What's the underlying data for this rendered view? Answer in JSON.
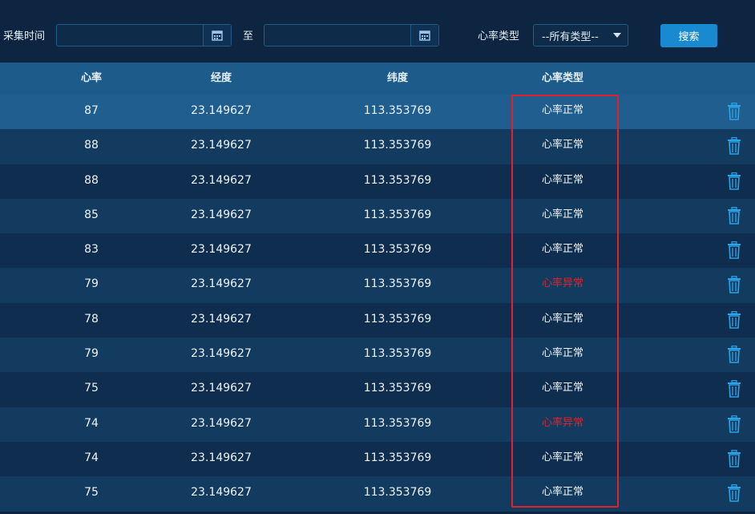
{
  "filters": {
    "time_label": "采集时间",
    "to_label": "至",
    "start_date_value": "",
    "end_date_value": "",
    "type_label": "心率类型",
    "type_select_value": "--所有类型--",
    "search_label": "搜索"
  },
  "table": {
    "headers": {
      "heart_rate": "心率",
      "longitude": "经度",
      "latitude": "纬度",
      "heart_rate_type": "心率类型"
    },
    "rows": [
      {
        "hr": "87",
        "lng": "23.149627",
        "lat": "113.353769",
        "type": "心率正常",
        "abnormal": false
      },
      {
        "hr": "88",
        "lng": "23.149627",
        "lat": "113.353769",
        "type": "心率正常",
        "abnormal": false
      },
      {
        "hr": "88",
        "lng": "23.149627",
        "lat": "113.353769",
        "type": "心率正常",
        "abnormal": false
      },
      {
        "hr": "85",
        "lng": "23.149627",
        "lat": "113.353769",
        "type": "心率正常",
        "abnormal": false
      },
      {
        "hr": "83",
        "lng": "23.149627",
        "lat": "113.353769",
        "type": "心率正常",
        "abnormal": false
      },
      {
        "hr": "79",
        "lng": "23.149627",
        "lat": "113.353769",
        "type": "心率异常",
        "abnormal": true
      },
      {
        "hr": "78",
        "lng": "23.149627",
        "lat": "113.353769",
        "type": "心率正常",
        "abnormal": false
      },
      {
        "hr": "79",
        "lng": "23.149627",
        "lat": "113.353769",
        "type": "心率正常",
        "abnormal": false
      },
      {
        "hr": "75",
        "lng": "23.149627",
        "lat": "113.353769",
        "type": "心率正常",
        "abnormal": false
      },
      {
        "hr": "74",
        "lng": "23.149627",
        "lat": "113.353769",
        "type": "心率异常",
        "abnormal": true
      },
      {
        "hr": "74",
        "lng": "23.149627",
        "lat": "113.353769",
        "type": "心率正常",
        "abnormal": false
      },
      {
        "hr": "75",
        "lng": "23.149627",
        "lat": "113.353769",
        "type": "心率正常",
        "abnormal": false
      }
    ]
  },
  "icons": {
    "calendar": "calendar-icon",
    "dropdown": "chevron-down-icon",
    "delete": "trash-icon"
  },
  "colors": {
    "background": "#0d2540",
    "header_bg": "#1c5b8a",
    "row_odd": "#133b5f",
    "row_even": "#0f2d4e",
    "row_selected": "#1f5e8e",
    "accent": "#1a8ad0",
    "abnormal_text": "#e0242a",
    "highlight_border": "#e4202a",
    "trash_icon": "#2aa4e6"
  }
}
